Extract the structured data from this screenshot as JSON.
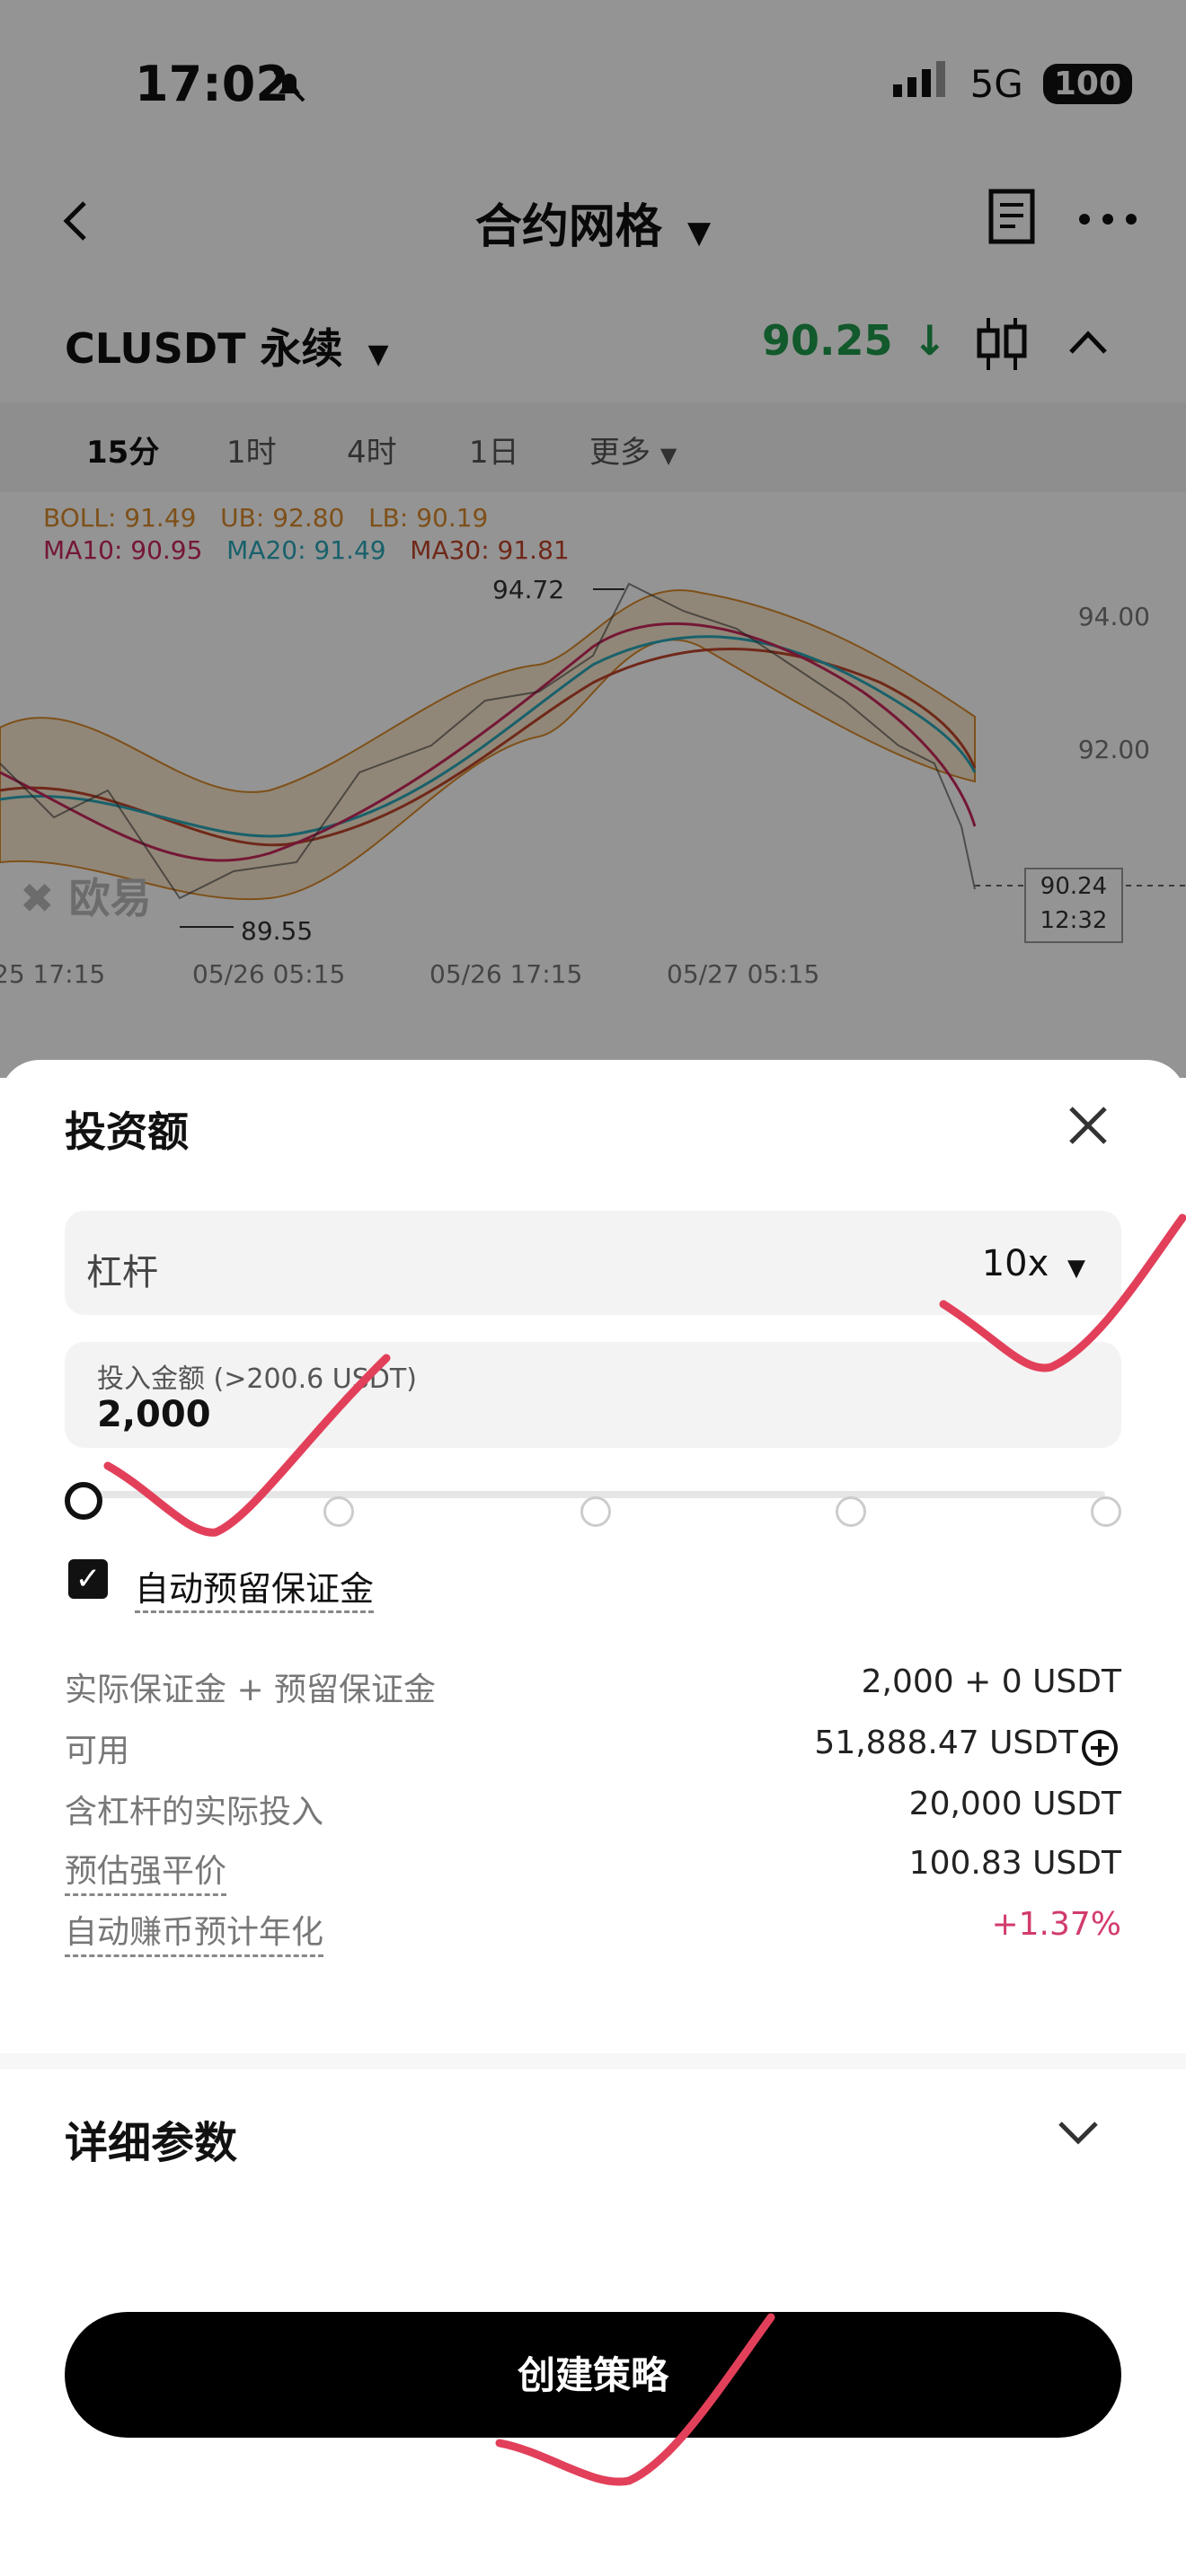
{
  "status_bar": {
    "time": "17:02",
    "network": "5G",
    "battery": "100"
  },
  "nav": {
    "title": "合约网格"
  },
  "instrument": {
    "pair": "CLUSDT 永续",
    "price": "90.25"
  },
  "timeframes": [
    "15分",
    "1时",
    "4时",
    "1日",
    "更多"
  ],
  "indicators": {
    "boll": "BOLL: 91.49",
    "ub": "UB: 92.80",
    "lb": "LB: 90.19",
    "ma10": "MA10: 90.95",
    "ma20": "MA20: 91.49",
    "ma30": "MA30: 91.81",
    "colors": {
      "boll": "#d98a2b",
      "ma10": "#c8285c",
      "ma20": "#2aa8b8",
      "ma30": "#c0462b"
    }
  },
  "chart": {
    "y_ticks": [
      "94.00",
      "92.00"
    ],
    "x_ticks": [
      "25 17:15",
      "05/26 05:15",
      "05/26 17:15",
      "05/27 05:15"
    ],
    "high_label": "94.72",
    "low_label": "89.55",
    "last_price": "90.24",
    "last_time": "12:32",
    "watermark": "欧易"
  },
  "sheet": {
    "title": "投资额",
    "leverage_label": "杠杆",
    "leverage_value": "10x",
    "amount_label": "投入金额 (>200.6 USDT)",
    "amount_value": "2,000",
    "auto_margin_label": "自动预留保证金",
    "rows": [
      {
        "label": "实际保证金 + 预留保证金",
        "value": "2,000 + 0 USDT"
      },
      {
        "label": "可用",
        "value": "51,888.47 USDT"
      },
      {
        "label": "含杠杆的实际投入",
        "value": "20,000 USDT"
      },
      {
        "label": "预估强平价",
        "value": "100.83 USDT"
      },
      {
        "label": "自动赚币预计年化",
        "value": "+1.37%"
      }
    ],
    "details_title": "详细参数",
    "cta": "创建策略",
    "accent_positive": "#d23b6b"
  }
}
